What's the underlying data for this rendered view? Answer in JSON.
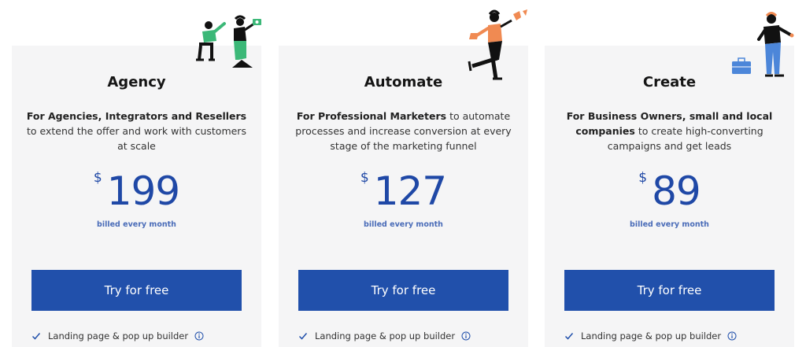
{
  "plans": [
    {
      "title": "Agency",
      "desc_bold": "For Agencies, Integrators and Resellers",
      "desc_rest": " to extend the offer and work with customers at scale",
      "currency": "$",
      "price": "199",
      "billing": "billed every month",
      "cta": "Try for free",
      "feature": "Landing page & pop up builder",
      "illustration": "two-people-illustration"
    },
    {
      "title": "Automate",
      "desc_bold": "For Professional Marketers",
      "desc_rest": " to automate processes and increase conversion at every stage of the marketing funnel",
      "currency": "$",
      "price": "127",
      "billing": "billed every month",
      "cta": "Try for free",
      "feature": "Landing page & pop up builder",
      "illustration": "walking-woman-illustration"
    },
    {
      "title": "Create",
      "desc_bold": "For Business Owners, small and local companies",
      "desc_rest": " to create high-converting campaigns and get leads",
      "currency": "$",
      "price": "89",
      "billing": "billed every month",
      "cta": "Try for free",
      "feature": "Landing page & pop up builder",
      "illustration": "businessman-with-briefcase-illustration"
    }
  ],
  "colors": {
    "accent": "#2150ab",
    "price": "#1f48a6",
    "card_bg": "#f5f5f6",
    "illustration_green": "#3cb878",
    "illustration_orange": "#f08a52",
    "illustration_blue": "#4c86d9"
  }
}
